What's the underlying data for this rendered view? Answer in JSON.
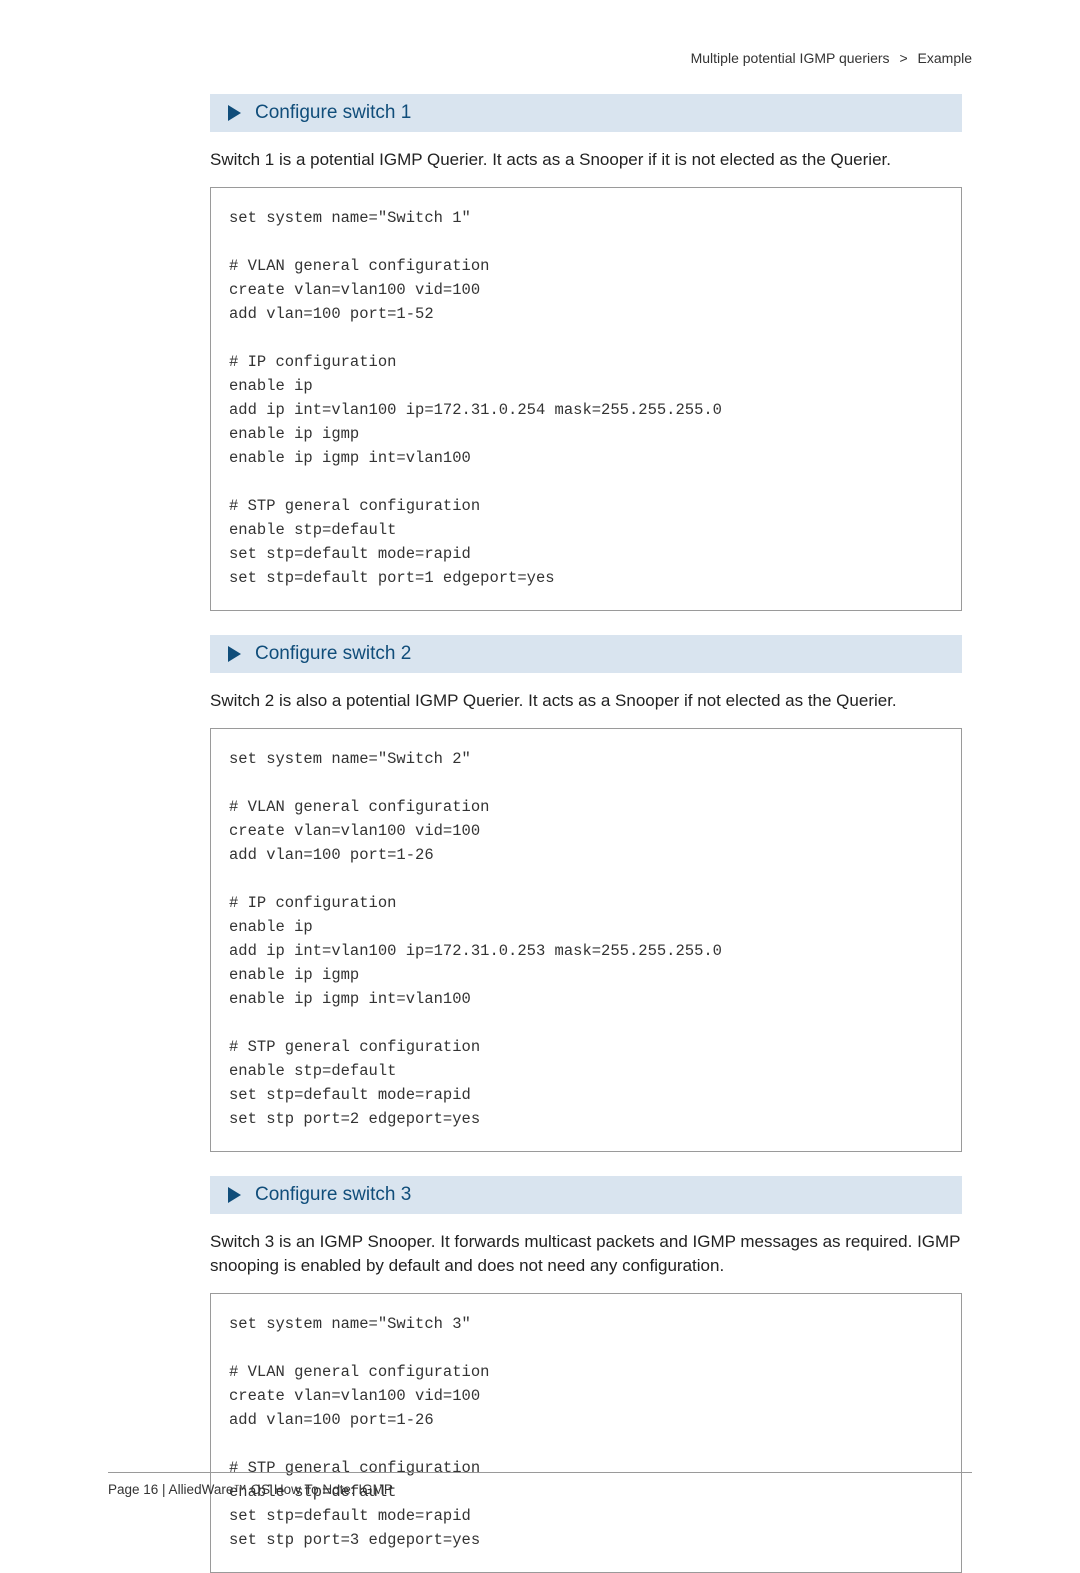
{
  "header": {
    "crumb_left": "Multiple potential IGMP queriers",
    "crumb_sep": ">",
    "crumb_right": "Example"
  },
  "sections": [
    {
      "title": "Configure switch 1",
      "intro": "Switch 1 is a potential IGMP Querier. It acts as a Snooper if it is not elected as the Querier.",
      "code": "set system name=\"Switch 1\"\n\n# VLAN general configuration\ncreate vlan=vlan100 vid=100\nadd vlan=100 port=1-52\n\n# IP configuration\nenable ip\nadd ip int=vlan100 ip=172.31.0.254 mask=255.255.255.0\nenable ip igmp\nenable ip igmp int=vlan100\n\n# STP general configuration\nenable stp=default\nset stp=default mode=rapid\nset stp=default port=1 edgeport=yes"
    },
    {
      "title": "Configure switch 2",
      "intro": "Switch 2 is also a potential IGMP Querier. It acts as a Snooper if not elected as the Querier.",
      "code": "set system name=\"Switch 2\"\n\n# VLAN general configuration\ncreate vlan=vlan100 vid=100\nadd vlan=100 port=1-26\n\n# IP configuration\nenable ip\nadd ip int=vlan100 ip=172.31.0.253 mask=255.255.255.0\nenable ip igmp\nenable ip igmp int=vlan100\n\n# STP general configuration\nenable stp=default\nset stp=default mode=rapid\nset stp port=2 edgeport=yes"
    },
    {
      "title": "Configure switch 3",
      "intro": "Switch 3 is an IGMP Snooper. It forwards multicast packets and IGMP messages as required. IGMP snooping is enabled by default and does not need any configuration.",
      "code": "set system name=\"Switch 3\"\n\n# VLAN general configuration\ncreate vlan=vlan100 vid=100\nadd vlan=100 port=1-26\n\n# STP general configuration\nenable stp=default\nset stp=default mode=rapid\nset stp port=3 edgeport=yes"
    }
  ],
  "footer": {
    "text": "Page 16 | AlliedWare™ OS How To Note: IGMP"
  }
}
